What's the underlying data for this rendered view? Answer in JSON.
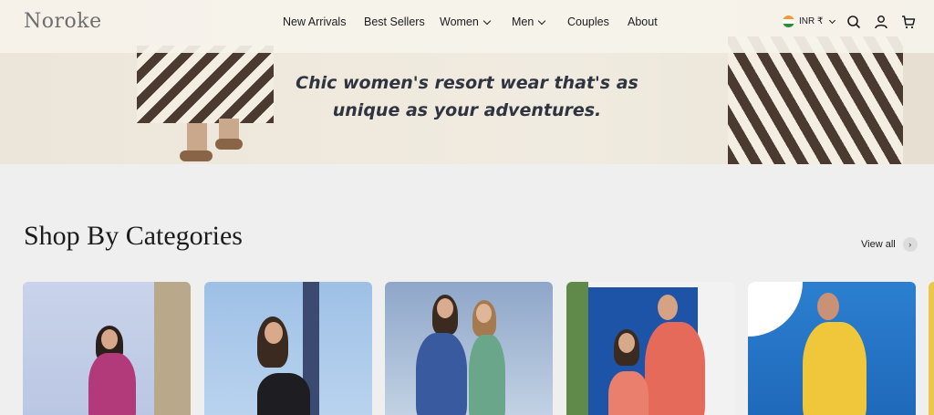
{
  "brand": {
    "logo": "Noroke"
  },
  "nav": {
    "items": [
      {
        "label": "New Arrivals",
        "has_dropdown": false
      },
      {
        "label": "Best Sellers",
        "has_dropdown": false
      },
      {
        "label": "Women",
        "has_dropdown": true
      },
      {
        "label": "Men",
        "has_dropdown": true
      },
      {
        "label": "Couples",
        "has_dropdown": false
      },
      {
        "label": "About",
        "has_dropdown": false
      }
    ]
  },
  "header_actions": {
    "currency": "INR ₹",
    "icons": [
      "search-icon",
      "account-icon",
      "cart-icon"
    ]
  },
  "hero": {
    "tagline_line1": "Chic women's resort wear that's as",
    "tagline_line2": "unique as your adventures."
  },
  "categories": {
    "title": "Shop By Categories",
    "view_all": "View all"
  },
  "colors": {
    "page_bg": "#efefef",
    "hero_bg": "#efe9de",
    "stripe_dark": "#4a3a30",
    "text_primary": "#1c1c1c",
    "logo_grey": "#6e6e6e"
  }
}
